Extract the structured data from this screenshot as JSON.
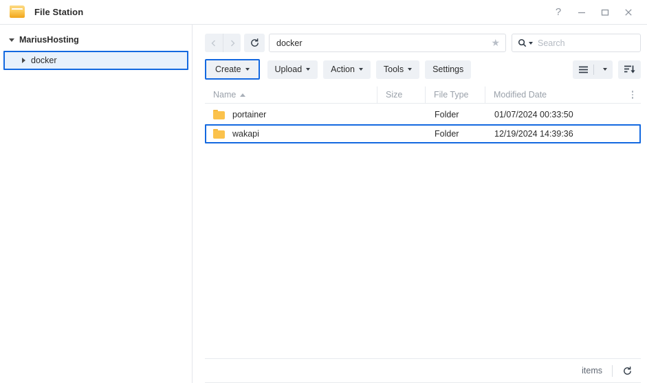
{
  "titlebar": {
    "icon": "folder-icon",
    "title": "File Station",
    "controls": [
      {
        "name": "help-button",
        "glyph": "?"
      },
      {
        "name": "minimize-button",
        "glyph": "minimize-icon"
      },
      {
        "name": "maximize-button",
        "glyph": "maximize-icon"
      },
      {
        "name": "close-button",
        "glyph": "close-icon"
      }
    ]
  },
  "sidebar": {
    "root": {
      "label": "MariusHosting",
      "expanded": true
    },
    "children": [
      {
        "label": "docker",
        "expanded": false,
        "selected": true
      }
    ]
  },
  "toolbar": {
    "back_icon": "chevron-left-icon",
    "forward_icon": "chevron-right-icon",
    "refresh_icon": "refresh-icon",
    "path_value": "docker",
    "path_placeholder": "",
    "favorite_icon": "star-icon",
    "search_icon": "search-icon",
    "search_placeholder": "Search",
    "search_value": "",
    "buttons": [
      {
        "label": "Create",
        "has_caret": true,
        "highlighted": true
      },
      {
        "label": "Upload",
        "has_caret": true,
        "highlighted": false
      },
      {
        "label": "Action",
        "has_caret": true,
        "highlighted": false
      },
      {
        "label": "Tools",
        "has_caret": true,
        "highlighted": false
      },
      {
        "label": "Settings",
        "has_caret": false,
        "highlighted": false
      }
    ],
    "view_mode_icon": "list-view-icon",
    "view_mode_caret": "chevron-down-icon",
    "sort_icon": "sort-descending-icon"
  },
  "filelist": {
    "columns": [
      {
        "key": "name",
        "label": "Name",
        "sort": "asc"
      },
      {
        "key": "size",
        "label": "Size",
        "sort": null
      },
      {
        "key": "type",
        "label": "File Type",
        "sort": null
      },
      {
        "key": "date",
        "label": "Modified Date",
        "sort": null
      }
    ],
    "column_menu_icon": "kebab-menu-icon",
    "rows": [
      {
        "icon": "folder-icon",
        "name": "portainer",
        "size": "",
        "type": "Folder",
        "date": "01/07/2024 00:33:50",
        "selected": false
      },
      {
        "icon": "folder-icon",
        "name": "wakapi",
        "size": "",
        "type": "Folder",
        "date": "12/19/2024 14:39:36",
        "selected": true
      }
    ]
  },
  "statusbar": {
    "items_label": "items",
    "refresh_icon": "refresh-icon"
  },
  "colors": {
    "accent": "#1268e0",
    "selection_bg": "#e8f1fc",
    "button_bg": "#eef1f5",
    "folder_yellow": "#fbc24c",
    "muted_text": "#9aa1aa"
  }
}
